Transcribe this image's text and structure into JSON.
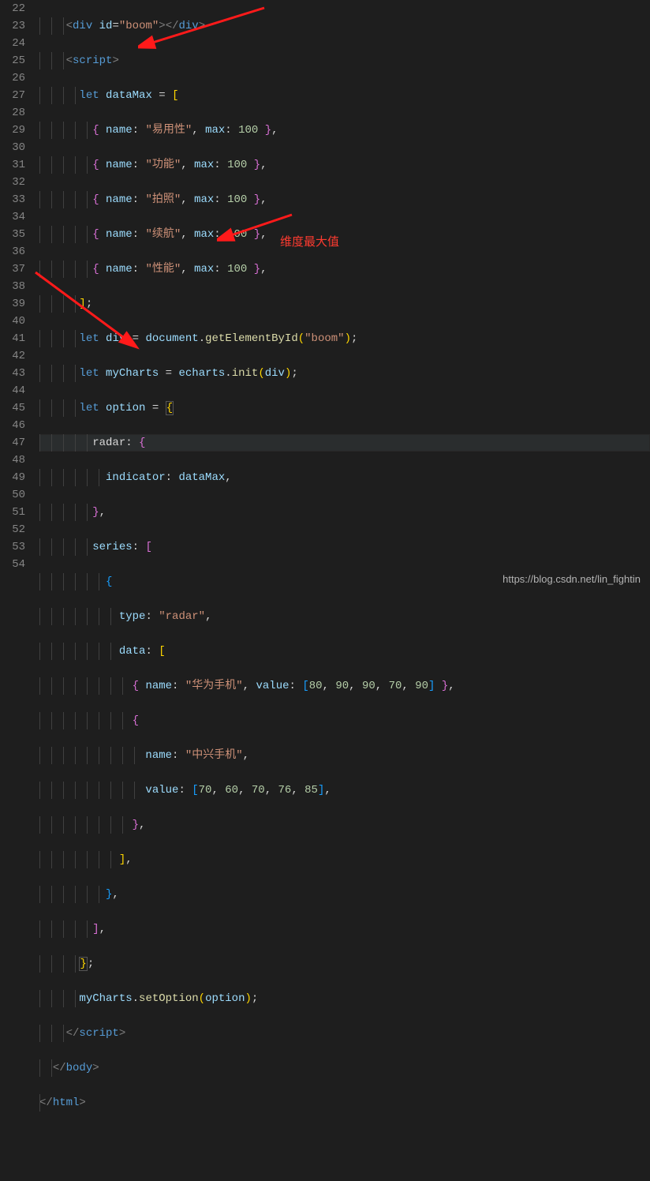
{
  "line_numbers": [
    "22",
    "23",
    "24",
    "25",
    "26",
    "27",
    "28",
    "29",
    "30",
    "31",
    "32",
    "33",
    "34",
    "35",
    "36",
    "37",
    "38",
    "39",
    "40",
    "41",
    "42",
    "43",
    "44",
    "45",
    "46",
    "47",
    "48",
    "49",
    "50",
    "51",
    "52",
    "53",
    "54"
  ],
  "code": {
    "l22_div_open": "<",
    "l22_div": "div",
    "l22_id_attr": "id",
    "l22_eq": "=",
    "l22_id_val": "\"boom\"",
    "l22_close1": ">",
    "l22_div_close_open": "</",
    "l22_div2": "div",
    "l22_close2": ">",
    "l23_script_open": "<",
    "l23_script": "script",
    "l23_close": ">",
    "l24_let": "let",
    "l24_var": "dataMax",
    "l24_eq": " = ",
    "l24_bracket": "[",
    "l25_brace_o": "{",
    "l25_name_key": "name",
    "l25_name_val": "\"易用性\"",
    "l25_max_key": "max",
    "l25_max_val": "100",
    "l25_brace_c": "}",
    "l26_name_val": "\"功能\"",
    "l27_name_val": "\"拍照\"",
    "l28_name_val": "\"续航\"",
    "l29_name_val": "\"性能\"",
    "l30_bracket_c": "]",
    "l31_let": "let",
    "l31_var": "div",
    "l31_document": "document",
    "l31_func": "getElementById",
    "l31_arg": "\"boom\"",
    "l32_let": "let",
    "l32_var": "myCharts",
    "l32_echarts": "echarts",
    "l32_init": "init",
    "l32_arg": "div",
    "l33_let": "let",
    "l33_var": "option",
    "l33_brace": "{",
    "l34_radar": "radar",
    "l34_brace": "{",
    "l35_indicator": "indicator",
    "l35_val": "dataMax",
    "l36_brace": "}",
    "l37_series": "series",
    "l37_bracket": "[",
    "l38_brace": "{",
    "l39_type": "type",
    "l39_val": "\"radar\"",
    "l40_data": "data",
    "l40_bracket": "[",
    "l41_brace_o": "{",
    "l41_name_key": "name",
    "l41_name_val": "\"华为手机\"",
    "l41_value_key": "value",
    "l41_vals": "[80, 90, 90, 70, 90]",
    "l41_brace_c": "}",
    "l42_brace": "{",
    "l43_name_key": "name",
    "l43_name_val": "\"中兴手机\"",
    "l44_value_key": "value",
    "l44_vals": "[70, 60, 70, 76, 85]",
    "l45_brace": "}",
    "l46_bracket": "]",
    "l47_brace": "}",
    "l48_bracket": "]",
    "l49_brace": "}",
    "l50_var": "myCharts",
    "l50_func": "setOption",
    "l50_arg": "option",
    "l51_script_close": "</",
    "l51_script": "script",
    "l51_gt": ">",
    "l52_body_close": "</",
    "l52_body": "body",
    "l52_gt": ">",
    "l53_html_close": "</",
    "l53_html": "html",
    "l53_gt": ">"
  },
  "annotation": "维度最大值",
  "watermark": "https://blog.csdn.net/lin_fightin"
}
